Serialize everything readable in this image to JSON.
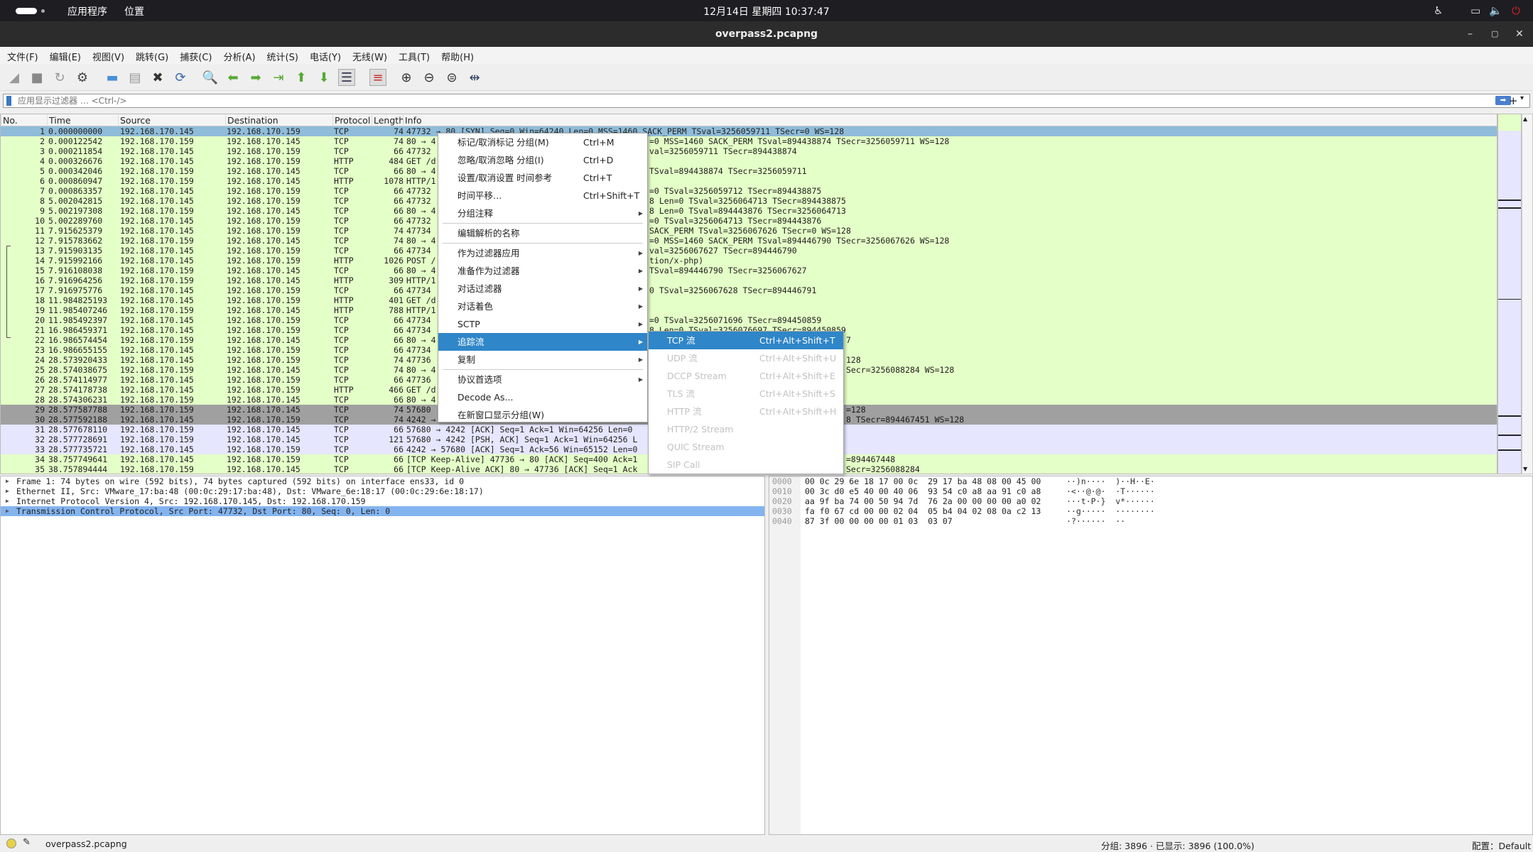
{
  "top_panel": {
    "activities": "activities",
    "apps": "应用程序",
    "places": "位置",
    "clock": "12月14日 星期四 10:37:47"
  },
  "window": {
    "title": "overpass2.pcapng"
  },
  "menubar": [
    "文件(F)",
    "编辑(E)",
    "视图(V)",
    "跳转(G)",
    "捕获(C)",
    "分析(A)",
    "统计(S)",
    "电话(Y)",
    "无线(W)",
    "工具(T)",
    "帮助(H)"
  ],
  "toolbar_icons": [
    "start-capture-icon",
    "stop-capture-icon",
    "restart-capture-icon",
    "capture-options-icon",
    "open-file-icon",
    "save-file-icon",
    "close-file-icon",
    "reload-file-icon",
    "find-packet-icon",
    "go-back-icon",
    "go-forward-icon",
    "go-to-packet-icon",
    "first-packet-icon",
    "last-packet-icon",
    "autoscroll-icon",
    "colorize-icon",
    "zoom-in-icon",
    "zoom-out-icon",
    "zoom-normal-icon",
    "resize-columns-icon"
  ],
  "filter": {
    "placeholder": "应用显示过滤器 … <Ctrl-/>",
    "value": ""
  },
  "colors": {
    "green_row": "#e4ffc7",
    "selected_row": "#8fbcd9",
    "gray_row": "#a0a0a0",
    "lavender_row": "#e7e6ff",
    "menu_highlight": "#2f86c8",
    "detail_selected": "#84b4ef"
  },
  "packet_list": {
    "columns": [
      "No.",
      "Time",
      "Source",
      "Destination",
      "Protocol",
      "Length",
      "Info"
    ],
    "rows": [
      {
        "no": "1",
        "time": "0.000000000",
        "src": "192.168.170.145",
        "dst": "192.168.170.159",
        "proto": "TCP",
        "len": "74",
        "info": "47732 → 80 [SYN] Seq=0 Win=64240 Len=0 MSS=1460 SACK_PERM TSval=3256059711 TSecr=0 WS=128",
        "info_right": "",
        "style": "selected"
      },
      {
        "no": "2",
        "time": "0.000122542",
        "src": "192.168.170.159",
        "dst": "192.168.170.145",
        "proto": "TCP",
        "len": "74",
        "info": "80 → 4",
        "info_right": "=0 MSS=1460 SACK_PERM TSval=894438874 TSecr=3256059711 WS=128",
        "style": "green"
      },
      {
        "no": "3",
        "time": "0.000211854",
        "src": "192.168.170.145",
        "dst": "192.168.170.159",
        "proto": "TCP",
        "len": "66",
        "info": "47732",
        "info_right": "val=3256059711 TSecr=894438874",
        "style": "green"
      },
      {
        "no": "4",
        "time": "0.000326676",
        "src": "192.168.170.145",
        "dst": "192.168.170.159",
        "proto": "HTTP",
        "len": "484",
        "info": "GET /d",
        "info_right": "",
        "style": "green"
      },
      {
        "no": "5",
        "time": "0.000342046",
        "src": "192.168.170.159",
        "dst": "192.168.170.145",
        "proto": "TCP",
        "len": "66",
        "info": "80 → 4",
        "info_right": "TSval=894438874 TSecr=3256059711",
        "style": "green"
      },
      {
        "no": "6",
        "time": "0.000860947",
        "src": "192.168.170.159",
        "dst": "192.168.170.145",
        "proto": "HTTP",
        "len": "1078",
        "info": "HTTP/1",
        "info_right": "",
        "style": "green"
      },
      {
        "no": "7",
        "time": "0.000863357",
        "src": "192.168.170.145",
        "dst": "192.168.170.159",
        "proto": "TCP",
        "len": "66",
        "info": "47732",
        "info_right": "=0 TSval=3256059712 TSecr=894438875",
        "style": "green"
      },
      {
        "no": "8",
        "time": "5.002042815",
        "src": "192.168.170.145",
        "dst": "192.168.170.159",
        "proto": "TCP",
        "len": "66",
        "info": "47732",
        "info_right": "8 Len=0 TSval=3256064713 TSecr=894438875",
        "style": "green"
      },
      {
        "no": "9",
        "time": "5.002197308",
        "src": "192.168.170.159",
        "dst": "192.168.170.145",
        "proto": "TCP",
        "len": "66",
        "info": "80 → 4",
        "info_right": "8 Len=0 TSval=894443876 TSecr=3256064713",
        "style": "green"
      },
      {
        "no": "10",
        "time": "5.002289760",
        "src": "192.168.170.145",
        "dst": "192.168.170.159",
        "proto": "TCP",
        "len": "66",
        "info": "47732",
        "info_right": "=0 TSval=3256064713 TSecr=894443876",
        "style": "green"
      },
      {
        "no": "11",
        "time": "7.915625379",
        "src": "192.168.170.145",
        "dst": "192.168.170.159",
        "proto": "TCP",
        "len": "74",
        "info": "47734",
        "info_right": " SACK_PERM TSval=3256067626 TSecr=0 WS=128",
        "style": "green"
      },
      {
        "no": "12",
        "time": "7.915783662",
        "src": "192.168.170.159",
        "dst": "192.168.170.145",
        "proto": "TCP",
        "len": "74",
        "info": "80 → 4",
        "info_right": "=0 MSS=1460 SACK_PERM TSval=894446790 TSecr=3256067626 WS=128",
        "style": "green"
      },
      {
        "no": "13",
        "time": "7.915903135",
        "src": "192.168.170.145",
        "dst": "192.168.170.159",
        "proto": "TCP",
        "len": "66",
        "info": "47734",
        "info_right": "val=3256067627 TSecr=894446790",
        "style": "green"
      },
      {
        "no": "14",
        "time": "7.915992166",
        "src": "192.168.170.145",
        "dst": "192.168.170.159",
        "proto": "HTTP",
        "len": "1026",
        "info": "POST /",
        "info_right": "tion/x-php)",
        "style": "green"
      },
      {
        "no": "15",
        "time": "7.916108038",
        "src": "192.168.170.159",
        "dst": "192.168.170.145",
        "proto": "TCP",
        "len": "66",
        "info": "80 → 4",
        "info_right": "TSval=894446790 TSecr=3256067627",
        "style": "green"
      },
      {
        "no": "16",
        "time": "7.916964256",
        "src": "192.168.170.159",
        "dst": "192.168.170.145",
        "proto": "HTTP",
        "len": "309",
        "info": "HTTP/1",
        "info_right": "",
        "style": "green"
      },
      {
        "no": "17",
        "time": "7.916975776",
        "src": "192.168.170.145",
        "dst": "192.168.170.159",
        "proto": "TCP",
        "len": "66",
        "info": "47734",
        "info_right": "0 TSval=3256067628 TSecr=894446791",
        "style": "green"
      },
      {
        "no": "18",
        "time": "11.984825193",
        "src": "192.168.170.145",
        "dst": "192.168.170.159",
        "proto": "HTTP",
        "len": "401",
        "info": "GET /d",
        "info_right": "",
        "style": "green"
      },
      {
        "no": "19",
        "time": "11.985407246",
        "src": "192.168.170.159",
        "dst": "192.168.170.145",
        "proto": "HTTP",
        "len": "788",
        "info": "HTTP/1",
        "info_right": "",
        "style": "green"
      },
      {
        "no": "20",
        "time": "11.985492397",
        "src": "192.168.170.145",
        "dst": "192.168.170.159",
        "proto": "TCP",
        "len": "66",
        "info": "47734",
        "info_right": "=0 TSval=3256071696 TSecr=894450859",
        "style": "green"
      },
      {
        "no": "21",
        "time": "16.986459371",
        "src": "192.168.170.145",
        "dst": "192.168.170.159",
        "proto": "TCP",
        "len": "66",
        "info": "47734",
        "info_right": "8 Len=0 TSval=3256076697 TSecr=894450859",
        "style": "green"
      },
      {
        "no": "22",
        "time": "16.986574454",
        "src": "192.168.170.159",
        "dst": "192.168.170.145",
        "proto": "TCP",
        "len": "66",
        "info": "80 → 4",
        "info_right": "7",
        "style": "green",
        "right_at": "sub"
      },
      {
        "no": "23",
        "time": "16.986655155",
        "src": "192.168.170.145",
        "dst": "192.168.170.159",
        "proto": "TCP",
        "len": "66",
        "info": "47734",
        "info_right": "",
        "style": "green"
      },
      {
        "no": "24",
        "time": "28.573920433",
        "src": "192.168.170.145",
        "dst": "192.168.170.159",
        "proto": "TCP",
        "len": "74",
        "info": "47736",
        "info_right": "128",
        "style": "green",
        "right_at": "sub"
      },
      {
        "no": "25",
        "time": "28.574038675",
        "src": "192.168.170.159",
        "dst": "192.168.170.145",
        "proto": "TCP",
        "len": "74",
        "info": "80 → 4",
        "info_right": "Secr=3256088284 WS=128",
        "style": "green",
        "right_at": "sub"
      },
      {
        "no": "26",
        "time": "28.574114977",
        "src": "192.168.170.145",
        "dst": "192.168.170.159",
        "proto": "TCP",
        "len": "66",
        "info": "47736",
        "info_right": "",
        "style": "green"
      },
      {
        "no": "27",
        "time": "28.574178738",
        "src": "192.168.170.145",
        "dst": "192.168.170.159",
        "proto": "HTTP",
        "len": "466",
        "info": "GET /d",
        "info_right": "",
        "style": "green"
      },
      {
        "no": "28",
        "time": "28.574306231",
        "src": "192.168.170.159",
        "dst": "192.168.170.145",
        "proto": "TCP",
        "len": "66",
        "info": "80 → 4",
        "info_right": "",
        "style": "green"
      },
      {
        "no": "29",
        "time": "28.577587788",
        "src": "192.168.170.159",
        "dst": "192.168.170.145",
        "proto": "TCP",
        "len": "74",
        "info": "57680",
        "info_right": "=128",
        "style": "gray",
        "right_at": "sub"
      },
      {
        "no": "30",
        "time": "28.577592188",
        "src": "192.168.170.145",
        "dst": "192.168.170.159",
        "proto": "TCP",
        "len": "74",
        "info": "4242 →",
        "info_right": "8 TSecr=894467451 WS=128",
        "style": "gray",
        "right_at": "sub"
      },
      {
        "no": "31",
        "time": "28.577678110",
        "src": "192.168.170.159",
        "dst": "192.168.170.145",
        "proto": "TCP",
        "len": "66",
        "info": "57680 → 4242 [ACK] Seq=1 Ack=1 Win=64256 Len=0",
        "info_right": "",
        "style": "lavender"
      },
      {
        "no": "32",
        "time": "28.577728691",
        "src": "192.168.170.159",
        "dst": "192.168.170.145",
        "proto": "TCP",
        "len": "121",
        "info": "57680 → 4242 [PSH, ACK] Seq=1 Ack=1 Win=64256 L",
        "info_right": "",
        "style": "lavender"
      },
      {
        "no": "33",
        "time": "28.577735721",
        "src": "192.168.170.145",
        "dst": "192.168.170.159",
        "proto": "TCP",
        "len": "66",
        "info": "4242 → 57680 [ACK] Seq=1 Ack=56 Win=65152 Len=0",
        "info_right": "",
        "style": "lavender"
      },
      {
        "no": "34",
        "time": "38.757749641",
        "src": "192.168.170.145",
        "dst": "192.168.170.159",
        "proto": "TCP",
        "len": "66",
        "info": "[TCP Keep-Alive] 47736 → 80 [ACK] Seq=400 Ack=1",
        "info_right": "=894467448",
        "style": "green",
        "right_at": "sub"
      },
      {
        "no": "35",
        "time": "38.757894444",
        "src": "192.168.170.159",
        "dst": "192.168.170.145",
        "proto": "TCP",
        "len": "66",
        "info": "[TCP Keep-Alive ACK] 80 → 47736 [ACK] Seq=1 Ack",
        "info_right": "Secr=3256088284",
        "style": "green",
        "right_at": "sub"
      }
    ]
  },
  "details": [
    "Frame 1: 74 bytes on wire (592 bits), 74 bytes captured (592 bits) on interface ens33, id 0",
    "Ethernet II, Src: VMware_17:ba:48 (00:0c:29:17:ba:48), Dst: VMware_6e:18:17 (00:0c:29:6e:18:17)",
    "Internet Protocol Version 4, Src: 192.168.170.145, Dst: 192.168.170.159",
    "Transmission Control Protocol, Src Port: 47732, Dst Port: 80, Seq: 0, Len: 0"
  ],
  "bytes": [
    {
      "offset": "0000",
      "hex": "00 0c 29 6e 18 17 00 0c  29 17 ba 48 08 00 45 00",
      "ascii": "··)n····  )··H··E·"
    },
    {
      "offset": "0010",
      "hex": "00 3c d0 e5 40 00 40 06  93 54 c0 a8 aa 91 c0 a8",
      "ascii": "·<··@·@·  ·T······"
    },
    {
      "offset": "0020",
      "hex": "aa 9f ba 74 00 50 94 7d  76 2a 00 00 00 00 a0 02",
      "ascii": "···t·P·}  v*······"
    },
    {
      "offset": "0030",
      "hex": "fa f0 67 cd 00 00 02 04  05 b4 04 02 08 0a c2 13",
      "ascii": "··g·····  ········"
    },
    {
      "offset": "0040",
      "hex": "87 3f 00 00 00 00 01 03  03 07",
      "ascii": "·?······  ··"
    }
  ],
  "context_menu": [
    {
      "label": "标记/取消标记 分组(M)",
      "shortcut": "Ctrl+M"
    },
    {
      "label": "忽略/取消忽略 分组(I)",
      "shortcut": "Ctrl+D"
    },
    {
      "label": "设置/取消设置 时间参考",
      "shortcut": "Ctrl+T"
    },
    {
      "label": "时间平移…",
      "shortcut": "Ctrl+Shift+T"
    },
    {
      "label": "分组注释",
      "submenu": true,
      "sep_after": true
    },
    {
      "label": "编辑解析的名称",
      "sep_after": true
    },
    {
      "label": "作为过滤器应用",
      "submenu": true
    },
    {
      "label": "准备作为过滤器",
      "submenu": true
    },
    {
      "label": "对话过滤器",
      "submenu": true
    },
    {
      "label": "对话着色",
      "submenu": true
    },
    {
      "label": "SCTP",
      "submenu": true
    },
    {
      "label": "追踪流",
      "submenu": true,
      "highlighted": true
    },
    {
      "label": "复制",
      "submenu": true,
      "sep_after": true
    },
    {
      "label": "协议首选项",
      "submenu": true
    },
    {
      "label": "Decode As..."
    },
    {
      "label": "在新窗口显示分组(W)"
    }
  ],
  "follow_submenu": [
    {
      "label": "TCP 流",
      "shortcut": "Ctrl+Alt+Shift+T",
      "highlighted": true
    },
    {
      "label": "UDP 流",
      "shortcut": "Ctrl+Alt+Shift+U",
      "disabled": true
    },
    {
      "label": "DCCP Stream",
      "shortcut": "Ctrl+Alt+Shift+E",
      "disabled": true
    },
    {
      "label": "TLS 流",
      "shortcut": "Ctrl+Alt+Shift+S",
      "disabled": true
    },
    {
      "label": "HTTP 流",
      "shortcut": "Ctrl+Alt+Shift+H",
      "disabled": true
    },
    {
      "label": "HTTP/2 Stream",
      "shortcut": "",
      "disabled": true
    },
    {
      "label": "QUIC Stream",
      "shortcut": "",
      "disabled": true
    },
    {
      "label": "SIP Call",
      "shortcut": "",
      "disabled": true
    }
  ],
  "status": {
    "file": "overpass2.pcapng",
    "packets": "分组: 3896 · 已显示: 3896 (100.0%)",
    "profile": "配置：Default"
  }
}
